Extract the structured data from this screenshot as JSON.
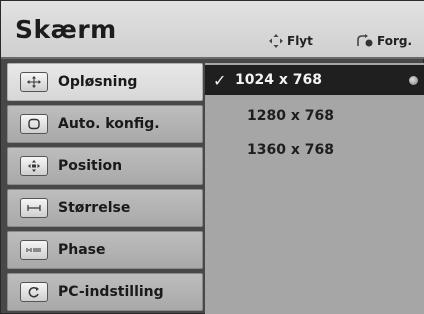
{
  "header": {
    "title": "Skærm",
    "hint_move": "Flyt",
    "hint_back": "Forg."
  },
  "menu": {
    "items": [
      {
        "label": "Opløsning",
        "icon": "resolution-icon",
        "active": true
      },
      {
        "label": "Auto. konfig.",
        "icon": "auto-config-icon",
        "active": false
      },
      {
        "label": "Position",
        "icon": "position-icon",
        "active": false
      },
      {
        "label": "Størrelse",
        "icon": "size-icon",
        "active": false
      },
      {
        "label": "Phase",
        "icon": "phase-icon",
        "active": false
      },
      {
        "label": "PC-indstilling",
        "icon": "pc-settings-icon",
        "active": false
      }
    ]
  },
  "options": {
    "items": [
      {
        "label": "1024 x 768",
        "selected": true
      },
      {
        "label": "1280 x 768",
        "selected": false
      },
      {
        "label": "1360 x 768",
        "selected": false
      }
    ]
  },
  "colors": {
    "header_bg": "#d8d8d8",
    "menu_active_bg": "#e0e0e0",
    "menu_bg": "#b3b3b3",
    "panel_bg": "#a6a6a6",
    "selected_bg": "#1f1f1f"
  }
}
